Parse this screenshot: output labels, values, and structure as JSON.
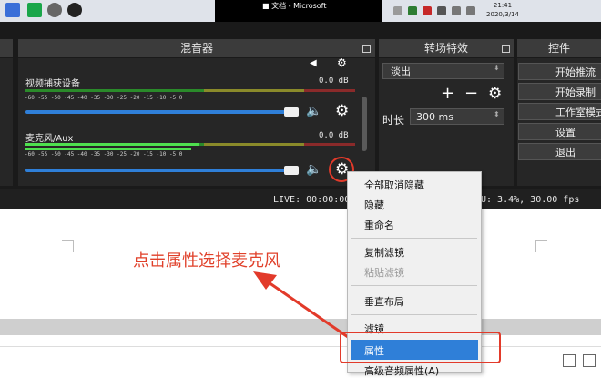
{
  "clock": {
    "time": "21:41",
    "date": "2020/3/14"
  },
  "taskbar": {
    "window_title": "■ 文档 - Microsoft"
  },
  "panels": {
    "mixer": "混音器",
    "transitions": "转场特效",
    "controls": "控件"
  },
  "mixer": {
    "channels": [
      {
        "name": "视频捕获设备",
        "db": "0.0 dB"
      },
      {
        "name": "麦克风/Aux",
        "db": "0.0 dB"
      }
    ],
    "scale": "-60 -55 -50 -45 -40 -35 -30 -25 -20 -15 -10 -5 0"
  },
  "transitions": {
    "selected": "淡出",
    "duration_label": "时长",
    "duration_value": "300 ms"
  },
  "controls": {
    "buttons": [
      "开始推流",
      "开始录制",
      "工作室模式",
      "设置",
      "退出"
    ]
  },
  "status": {
    "live": "LIVE: 00:00:00",
    "cpu": "U: 3.4%, 30.00 fps"
  },
  "context_menu": {
    "items": [
      "全部取消隐藏",
      "隐藏",
      "重命名",
      "复制滤镜",
      "粘贴滤镜",
      "垂直布局",
      "滤镜",
      "属性",
      "高级音频属性(A)"
    ],
    "selected": "属性"
  },
  "annotation": "点击属性选择麦克风",
  "colors": {
    "accent": "#2f7fd8",
    "highlight": "#e23a2a",
    "obs_bg": "#1a1a1a",
    "annotation": "#e0402a"
  }
}
